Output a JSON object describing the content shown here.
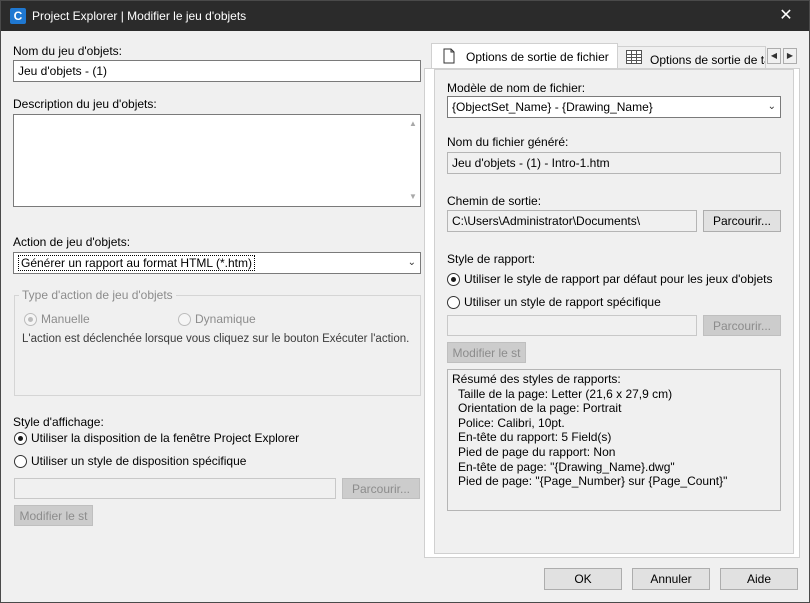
{
  "window": {
    "title": "Project Explorer | Modifier le jeu d'objets",
    "app_icon": "C",
    "close_glyph": "✕"
  },
  "left": {
    "name_label": "Nom du jeu d'objets:",
    "name_value": "Jeu d'objets - (1)",
    "description_label": "Description du jeu d'objets:",
    "description_value": "",
    "action_label": "Action de jeu d'objets:",
    "action_value": "Générer un rapport au format HTML (*.htm)",
    "action_type_group": {
      "title": "Type d'action de jeu d'objets",
      "manual_label": "Manuelle",
      "dynamic_label": "Dynamique",
      "info_text": "L'action est déclenchée lorsque vous cliquez sur le bouton Exécuter l'action."
    },
    "display_style_label": "Style d'affichage:",
    "use_explorer_layout_label": "Utiliser la disposition de la fenêtre Project Explorer",
    "use_specific_layout_label": "Utiliser un style de disposition spécifique",
    "layout_path_value": "",
    "browse_label": "Parcourir...",
    "modify_style_label": "Modifier le st"
  },
  "tabs": [
    {
      "label": "Options de sortie de fichier",
      "icon": "page-icon",
      "active": true
    },
    {
      "label": "Options de sortie de ta",
      "icon": "table-icon",
      "active": false
    }
  ],
  "tab_scroll": {
    "left": "◀",
    "right": "▶"
  },
  "right": {
    "filename_model_label": "Modèle de nom de fichier:",
    "filename_model_value": "{ObjectSet_Name} - {Drawing_Name}",
    "generated_filename_label": "Nom du fichier généré:",
    "generated_filename_value": "Jeu d'objets - (1) - Intro-1.htm",
    "output_path_label": "Chemin de sortie:",
    "output_path_value": "C:\\Users\\Administrator\\Documents\\",
    "browse_label": "Parcourir...",
    "report_style_label": "Style de rapport:",
    "use_default_style_label": "Utiliser le style de rapport par défaut pour les jeux d'objets",
    "use_specific_style_label": "Utiliser un style de rapport spécifique",
    "specific_style_value": "",
    "browse_disabled_label": "Parcourir...",
    "modify_style_label": "Modifier le st",
    "summary": {
      "title": "Résumé des styles de rapports:",
      "lines": [
        "Taille de la page: Letter (21,6 x 27,9 cm)",
        "Orientation de la page: Portrait",
        "Police: Calibri, 10pt.",
        "En-tête du rapport: 5 Field(s)",
        "Pied de page du rapport: Non",
        "En-tête de page: \"{Drawing_Name}.dwg\"",
        "Pied de page: \"{Page_Number} sur {Page_Count}\""
      ]
    }
  },
  "footer": {
    "ok_label": "OK",
    "cancel_label": "Annuler",
    "help_label": "Aide"
  }
}
